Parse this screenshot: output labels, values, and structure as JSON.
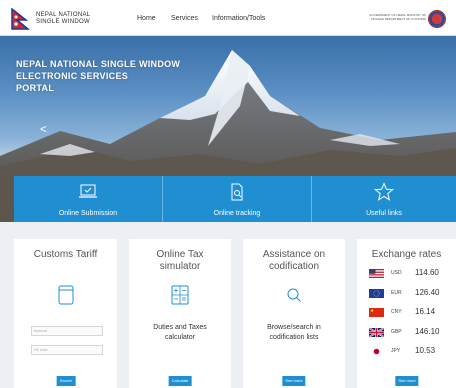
{
  "header": {
    "brand_line1": "NEPAL NATIONAL",
    "brand_line2": "SINGLE WINDOW",
    "nav": [
      "Home",
      "Services",
      "Information/Tools"
    ],
    "gov_text": "GOVERNMENT OF NEPAL MINISTRY OF FINANCE DEPARTMENT OF CUSTOMS"
  },
  "hero": {
    "title_line1": "NEPAL NATIONAL SINGLE WINDOW",
    "title_line2": "ELECTRONIC SERVICES",
    "title_line3": "PORTAL",
    "prev_arrow": "<"
  },
  "services": [
    {
      "label": "Online Submission",
      "icon": "laptop-icon"
    },
    {
      "label": "Online tracking",
      "icon": "document-search-icon"
    },
    {
      "label": "Useful links",
      "icon": "star-icon"
    }
  ],
  "cards": {
    "tariff": {
      "title": "Customs Tariff",
      "input1_placeholder": "keyword",
      "input2_placeholder": "HS code",
      "button": "Search"
    },
    "tax": {
      "title_line1": "Online Tax",
      "title_line2": "simulator",
      "desc_line1": "Duties and Taxes",
      "desc_line2": "calculator",
      "button": "Calculate"
    },
    "codification": {
      "title_line1": "Assistance on",
      "title_line2": "codification",
      "desc_line1": "Browse/search in",
      "desc_line2": "codification lists",
      "button": "See more"
    },
    "exchange": {
      "title": "Exchange rates",
      "rates": [
        {
          "code": "USD",
          "value": "114.60"
        },
        {
          "code": "EUR",
          "value": "126.40"
        },
        {
          "code": "CNY",
          "value": "16.14"
        },
        {
          "code": "GBP",
          "value": "146.10"
        },
        {
          "code": "JPY",
          "value": "10.53"
        }
      ],
      "button": "See more"
    }
  },
  "colors": {
    "accent": "#1f8fd1",
    "page_bg": "#eceff3"
  }
}
